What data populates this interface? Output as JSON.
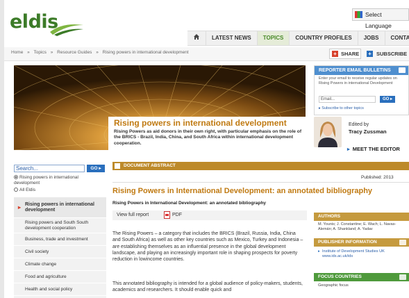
{
  "header": {
    "logo_text": "eldis",
    "language_label": "Select Language",
    "nav": [
      {
        "label": "LATEST NEWS",
        "active": false
      },
      {
        "label": "TOPICS",
        "active": true
      },
      {
        "label": "COUNTRY PROFILES",
        "active": false
      },
      {
        "label": "JOBS",
        "active": false
      },
      {
        "label": "CONTACT",
        "active": false
      }
    ]
  },
  "breadcrumb": [
    "Home",
    "»",
    "Topics",
    "»",
    "Resource Guides",
    "»",
    "Rising powers in international development"
  ],
  "actions": {
    "share_label": "SHARE",
    "subscribe_label": "SUBSCRIBE"
  },
  "hero": {
    "title": "Rising powers in international development",
    "description": "Rising Powers as aid donors in their own right, with particular emphasis on the role of the BRICS - Brazil, India, China, and South Africa within international development cooperation."
  },
  "editor": {
    "edited_by": "Edited by",
    "name": "Tracy Zussman",
    "meet_label": "MEET THE EDITOR"
  },
  "reporter": {
    "title": "REPORTER EMAIL BULLETINS",
    "text": "Enter your email to receive regular updates on Rising Powers in international Development",
    "email_placeholder": "Email...",
    "go_label": "GO",
    "subscribe_link": "Subscribe to other topics"
  },
  "sidebar": {
    "search_placeholder": "Search...",
    "go_label": "GO",
    "radio_scoped": "Rising powers in international development",
    "radio_all": "All Eldis",
    "topics": [
      "Rising powers in international development",
      "Rising powers and South South development cooperation",
      "Business, trade and investment",
      "Civil society",
      "Climate change",
      "Food and agriculture",
      "Health and social policy"
    ]
  },
  "main": {
    "abstract_label": "DOCUMENT ABSTRACT",
    "published": "Published: 2013",
    "title": "Rising Powers in International Development: an annotated bibliography",
    "subtitle": "Rising Powers in International Development: an annotated bibliography",
    "view_full_report": "View full report",
    "pdf_label": "PDF",
    "paragraph1": "The Rising Powers – a category that includes the BRICS (Brazil, Russia, India, China and South Africa) as well as other key countries such as Mexico, Turkey and Indonesia – are establishing themselves as an influential presence in the global development landscape, and playing an increasingly important role in shaping prospects for poverty reduction in lowincome countries.",
    "paragraph2": "This annotated bibliography is intended for a global audience of policy-makers, students, academics and researchers. It should enable quick and"
  },
  "right": {
    "authors_title": "AUTHORS",
    "authors_text": "M. Younis; J. Constantine; E. Wach; L. Navas-Alemán; A. Shankland; A. Yadav",
    "publisher_title": "PUBLISHER INFORMATION",
    "publisher_text": "Institute of Development Studies UK www.ids.ac.uk/ids",
    "focus_title": "FOCUS COUNTRIES",
    "focus_text": "Geographic focus"
  }
}
